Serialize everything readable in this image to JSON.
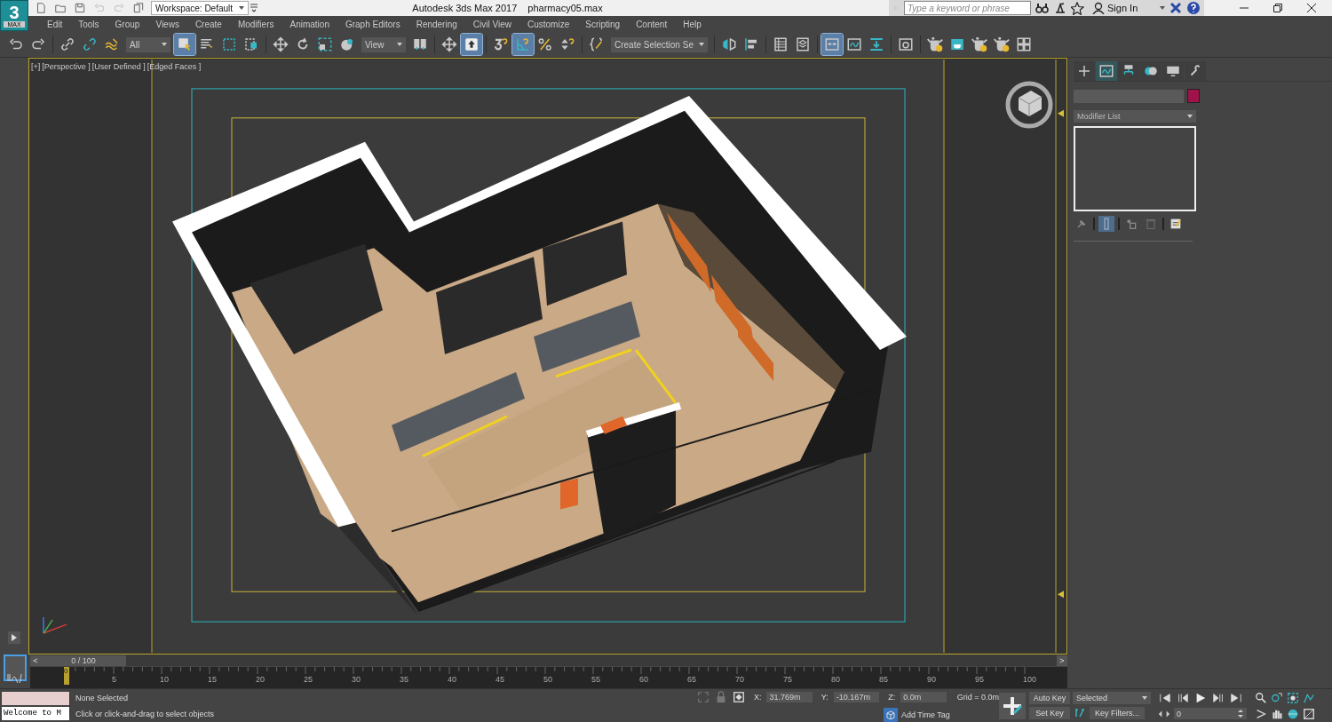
{
  "app_button": {
    "logo": "3",
    "label": "MAX"
  },
  "quick_access": [
    {
      "kind": "new"
    },
    {
      "kind": "open"
    },
    {
      "kind": "save"
    },
    {
      "kind": "undo"
    },
    {
      "kind": "redo"
    },
    {
      "kind": "project"
    }
  ],
  "workspace": {
    "value": "Workspace: Default"
  },
  "title": {
    "app": "Autodesk 3ds Max 2017",
    "file": "pharmacy05.max"
  },
  "search": {
    "placeholder": "Type a keyword or phrase"
  },
  "sign_in": "Sign In",
  "menu": [
    "Edit",
    "Tools",
    "Group",
    "Views",
    "Create",
    "Modifiers",
    "Animation",
    "Graph Editors",
    "Rendering",
    "Civil View",
    "Customize",
    "Scripting",
    "Content",
    "Help"
  ],
  "toolbar": [
    {
      "kind": "undo",
      "selected": false
    },
    {
      "kind": "redo",
      "selected": false
    },
    {
      "kind": "separator"
    },
    {
      "kind": "link",
      "selected": false
    },
    {
      "kind": "unlink",
      "selected": false
    },
    {
      "kind": "wave",
      "selected": false
    },
    {
      "kind": "dropdown",
      "value": "All"
    },
    {
      "kind": "select",
      "selected": true
    },
    {
      "kind": "list",
      "selected": false
    },
    {
      "kind": "marquee",
      "selected": false
    },
    {
      "kind": "crossing",
      "selected": false
    },
    {
      "kind": "separator"
    },
    {
      "kind": "move",
      "selected": false
    },
    {
      "kind": "rotate",
      "selected": false
    },
    {
      "kind": "scale",
      "selected": false
    },
    {
      "kind": "place",
      "selected": false
    },
    {
      "kind": "dropdown",
      "value": "View"
    },
    {
      "kind": "pivot",
      "selected": false
    },
    {
      "kind": "separator"
    },
    {
      "kind": "move",
      "selected": false
    },
    {
      "kind": "arrow-up",
      "selected": true
    },
    {
      "kind": "separator"
    },
    {
      "kind": "snap",
      "selected": false
    },
    {
      "kind": "angle",
      "selected": true
    },
    {
      "kind": "percent",
      "selected": false
    },
    {
      "kind": "spinner",
      "selected": false
    },
    {
      "kind": "separator"
    },
    {
      "kind": "braces",
      "selected": false
    },
    {
      "kind": "dropdown",
      "value": "Create Selection Se"
    },
    {
      "kind": "separator"
    },
    {
      "kind": "mirror",
      "selected": false
    },
    {
      "kind": "align",
      "selected": false
    },
    {
      "kind": "separator"
    },
    {
      "kind": "table",
      "selected": false
    },
    {
      "kind": "layers",
      "selected": false
    },
    {
      "kind": "separator"
    },
    {
      "kind": "ribbon",
      "selected": true
    },
    {
      "kind": "curve",
      "selected": false
    },
    {
      "kind": "download",
      "selected": false
    },
    {
      "kind": "separator"
    },
    {
      "kind": "material",
      "selected": false
    },
    {
      "kind": "separator"
    },
    {
      "kind": "teapot",
      "selected": false
    },
    {
      "kind": "frame",
      "selected": false
    },
    {
      "kind": "teapot",
      "selected": false
    },
    {
      "kind": "teapot",
      "selected": false
    },
    {
      "kind": "grid",
      "selected": false
    }
  ],
  "viewport": {
    "labels": [
      "[+]",
      "[Perspective ]",
      "[User Defined ]",
      "[Edged Faces ]"
    ]
  },
  "command_panel": {
    "tabs": [
      {
        "kind": "plus",
        "selected": false
      },
      {
        "kind": "curve",
        "selected": true
      },
      {
        "kind": "hierarchy",
        "selected": false
      },
      {
        "kind": "motion",
        "selected": false
      },
      {
        "kind": "display",
        "selected": false
      },
      {
        "kind": "wrench",
        "selected": false
      }
    ],
    "object_swatch": {
      "color": "#a0124a"
    },
    "modifier_list": "Modifier List",
    "stack_buttons": [
      {
        "kind": "pin",
        "selected": false
      },
      {
        "kind": "bar",
        "selected": true
      },
      {
        "kind": "unique",
        "selected": false
      },
      {
        "kind": "trash",
        "selected": false
      },
      {
        "kind": "configure",
        "selected": false
      }
    ]
  },
  "timeline": {
    "prev": "<",
    "frame_counter": "0 / 100",
    "next": ">",
    "level": 0,
    "current": "0",
    "ticks": [
      "5",
      "10",
      "15",
      "20",
      "25",
      "30",
      "35",
      "40",
      "45",
      "50",
      "55",
      "60",
      "65",
      "70",
      "75",
      "80",
      "85",
      "90",
      "95",
      "100"
    ]
  },
  "status": {
    "listener_output": "Welcome to M",
    "selection": "None Selected",
    "prompt": "Click or click-and-drag to select objects",
    "x_label": "X:",
    "x": "31.769m",
    "y_label": "Y:",
    "y": "-10.167m",
    "z_label": "Z:",
    "z": "0.0m",
    "grid": "Grid = 0.0m",
    "add_time_tag": "Add Time Tag",
    "auto_key": "Auto Key",
    "key_mode": "Selected",
    "set_key": "Set Key",
    "key_filters": "Key Filters...",
    "frame": "0"
  }
}
